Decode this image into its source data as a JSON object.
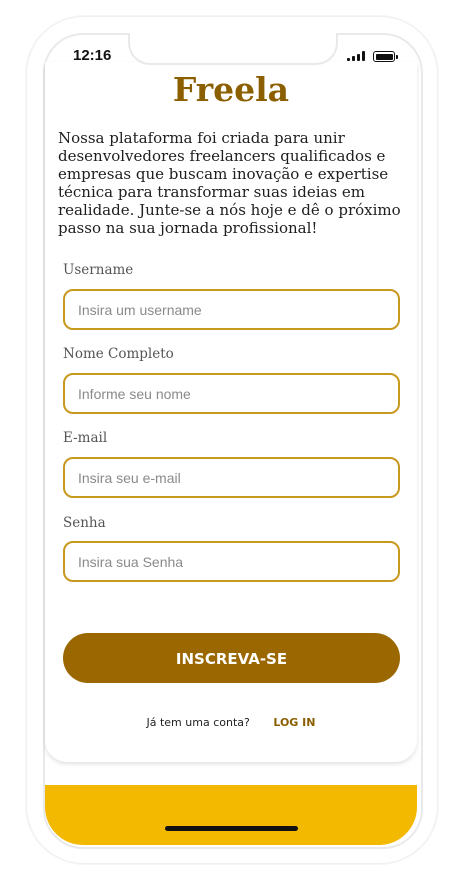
{
  "status_bar": {
    "time": "12:16"
  },
  "brand": {
    "title": "Freela",
    "color": "#8b5e00"
  },
  "intro": {
    "text": "Nossa plataforma foi criada para unir desenvolvedores freelancers qualificados e empresas que buscam inovação e expertise técnica para transformar suas ideias em realidade. Junte-se a nós hoje e dê o próximo passo na sua jornada profissional!"
  },
  "form": {
    "fields": [
      {
        "label": "Username",
        "placeholder": "Insira um username",
        "value": ""
      },
      {
        "label": "Nome Completo",
        "placeholder": "Informe seu nome",
        "value": ""
      },
      {
        "label": "E-mail",
        "placeholder": "Insira seu e-mail",
        "value": ""
      },
      {
        "label": "Senha",
        "placeholder": "Insira sua Senha",
        "value": ""
      }
    ],
    "input_border_color": "#c8991f",
    "submit_label": "INSCREVA-SE",
    "submit_color": "#9a6700"
  },
  "login": {
    "question": "Já tem uma conta?",
    "link_label": "LOG IN"
  },
  "footer": {
    "band_color": "#f3b800"
  },
  "icons": {
    "signal": "signal-icon",
    "battery": "battery-icon"
  }
}
